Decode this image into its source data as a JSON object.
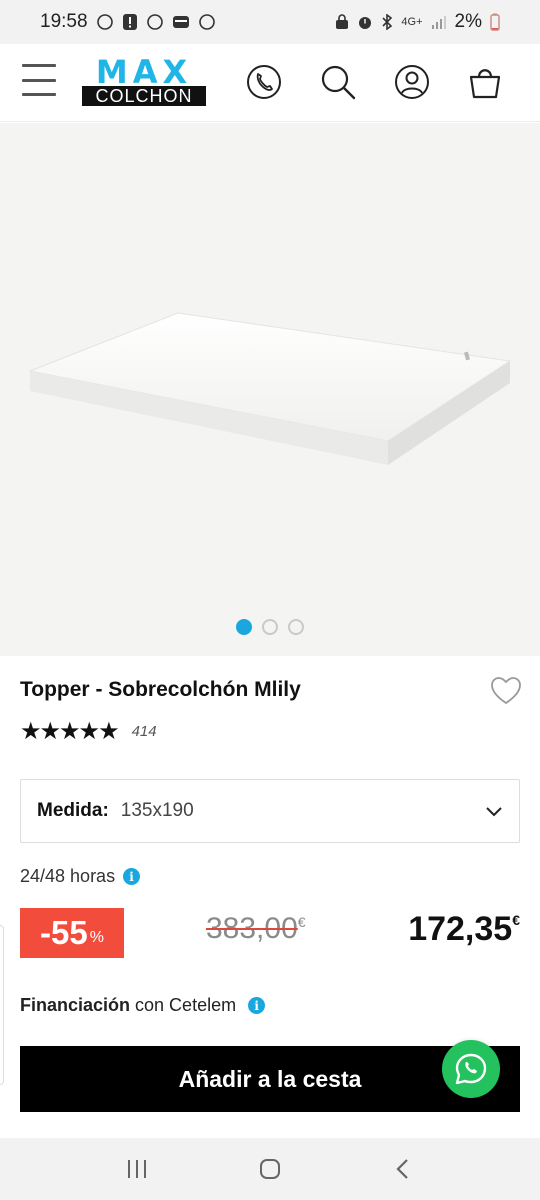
{
  "status_bar": {
    "time": "19:58",
    "battery": "2%",
    "network": "4G+"
  },
  "header": {
    "logo_top": "MAX",
    "logo_bottom": "COLCHON",
    "icons": [
      "menu-icon",
      "phone-icon",
      "search-icon",
      "user-icon",
      "cart-icon"
    ]
  },
  "gallery": {
    "image_label": "Topper mattress image",
    "slides": 3,
    "active_slide": 1
  },
  "product": {
    "title": "Topper - Sobrecolchón Mlily",
    "rating_stars": "★★★★★",
    "rating_value": 5,
    "rating_count": "414",
    "size_label": "Medida:",
    "size_value": "135x190",
    "delivery": "24/48 horas",
    "discount_value": "-55",
    "discount_unit": "%",
    "old_price": "383,00",
    "currency": "€",
    "new_price": "172,35",
    "finance_bold": "Financiación",
    "finance_rest": "con Cetelem",
    "add_to_cart": "Añadir a la cesta"
  },
  "colors": {
    "brand_blue": "#1fb5e6",
    "discount_red": "#f24c3d",
    "whatsapp_green": "#23c25f",
    "button_black": "#000000"
  }
}
